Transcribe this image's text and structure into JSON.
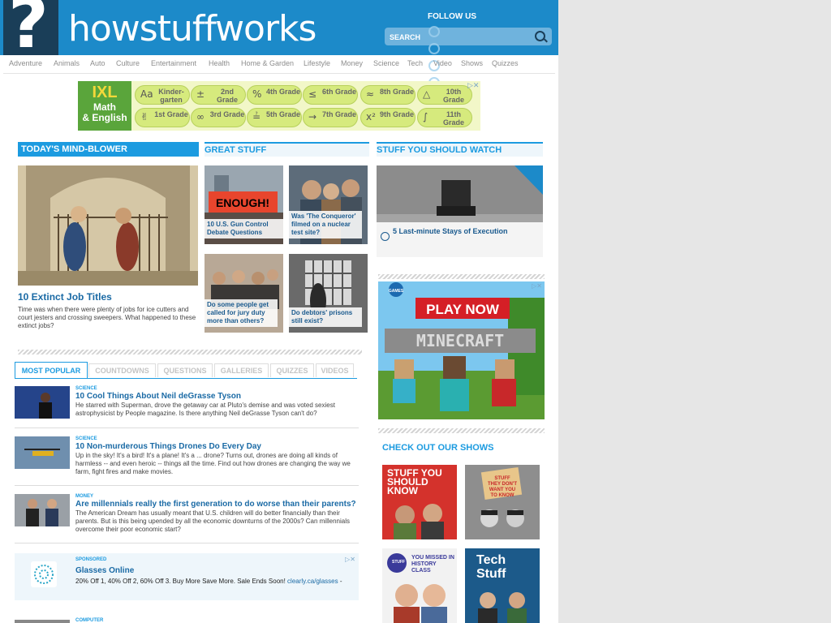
{
  "header": {
    "logo_mark": "?",
    "logo_text": "howstuffworks",
    "follow_us": "FOLLOW US",
    "search_placeholder": "SEARCH",
    "social_icons": [
      "facebook-icon",
      "youtube-icon",
      "twitter-icon",
      "pinterest-icon"
    ]
  },
  "nav": [
    "Adventure",
    "Animals",
    "Auto",
    "Culture",
    "Entertainment",
    "Health",
    "Home & Garden",
    "Lifestyle",
    "Money",
    "Science",
    "Tech",
    "Video",
    "Shows",
    "Quizzes"
  ],
  "ad_ixl": {
    "brand": "IXL",
    "subtitle1": "Math",
    "subtitle2": "& English",
    "grades": [
      {
        "icon": "Aa",
        "label": "Kinder-garten"
      },
      {
        "icon": "±",
        "label": "2nd Grade"
      },
      {
        "icon": "%",
        "label": "4th Grade"
      },
      {
        "icon": "≤",
        "label": "6th Grade"
      },
      {
        "icon": "≈",
        "label": "8th Grade"
      },
      {
        "icon": "△",
        "label": "10th Grade"
      },
      {
        "icon": "✌",
        "label": "1st Grade"
      },
      {
        "icon": "∞",
        "label": "3rd Grade"
      },
      {
        "icon": "≟",
        "label": "5th Grade"
      },
      {
        "icon": "→",
        "label": "7th Grade"
      },
      {
        "icon": "x²",
        "label": "9th Grade"
      },
      {
        "icon": "∫",
        "label": "11th Grade"
      }
    ],
    "close": "▷✕"
  },
  "sections": {
    "mind_blower": "TODAY'S MIND-BLOWER",
    "great_stuff": "GREAT STUFF",
    "watch": "STUFF YOU SHOULD WATCH",
    "shows": "CHECK OUT OUR SHOWS"
  },
  "hero": {
    "title": "10 Extinct Job Titles",
    "description": "Time was when there were plenty of jobs for ice cutters and court jesters and crossing sweepers. What happened to these extinct jobs?"
  },
  "great_stuff": [
    {
      "caption": "10 U.S. Gun Control Debate Questions",
      "sign": "ENOUGH!"
    },
    {
      "caption": "Was 'The Conqueror' filmed on a nuclear test site?"
    },
    {
      "caption": "Do some people get called for jury duty more than others?"
    },
    {
      "caption": "Do debtors' prisons still exist?"
    }
  ],
  "watch": {
    "caption": "5 Last-minute Stays of Execution"
  },
  "tabs": [
    "MOST POPULAR",
    "COUNTDOWNS",
    "QUESTIONS",
    "GALLERIES",
    "QUIZZES",
    "VIDEOS"
  ],
  "articles": [
    {
      "category": "SCIENCE",
      "title": "10 Cool Things About Neil deGrasse Tyson",
      "description": "He starred with Superman, drove the getaway car at Pluto's demise and was voted sexiest astrophysicist by People magazine. Is there anything Neil deGrasse Tyson can't do?"
    },
    {
      "category": "SCIENCE",
      "title": "10 Non-murderous Things Drones Do Every Day",
      "description": "Up in the sky! It's a bird! It's a plane! It's a ... drone? Turns out, drones are doing all kinds of harmless -- and even heroic -- things all the time. Find out how drones are changing the way we farm, fight fires and make movies."
    },
    {
      "category": "MONEY",
      "title": "Are millennials really the first generation to do worse than their parents?",
      "description": "The American Dream has usually meant that U.S. children will do better financially than their parents. But is this being upended by all the economic downturns of the 2000s? Can millennials overcome their poor economic start?"
    }
  ],
  "sponsored": {
    "category": "SPONSORED",
    "title": "Glasses Online",
    "description": "20% Off 1, 40% Off 2, 60% Off 3. Buy More Save More. Sale Ends Soon!",
    "link": "clearly.ca/glasses",
    "link_suffix": " -"
  },
  "next_category": "COMPUTER",
  "minecraft_ad": {
    "top": "GAMES",
    "cta": "PLAY NOW",
    "game": "MINECRAFT"
  },
  "shows": [
    {
      "title": "STUFF YOU SHOULD KNOW"
    },
    {
      "title": "STUFF THEY DON'T WANT YOU TO KNOW"
    },
    {
      "badge": "STUFF",
      "title": "YOU MISSED IN HISTORY CLASS"
    },
    {
      "title": "Tech Stuff"
    }
  ]
}
